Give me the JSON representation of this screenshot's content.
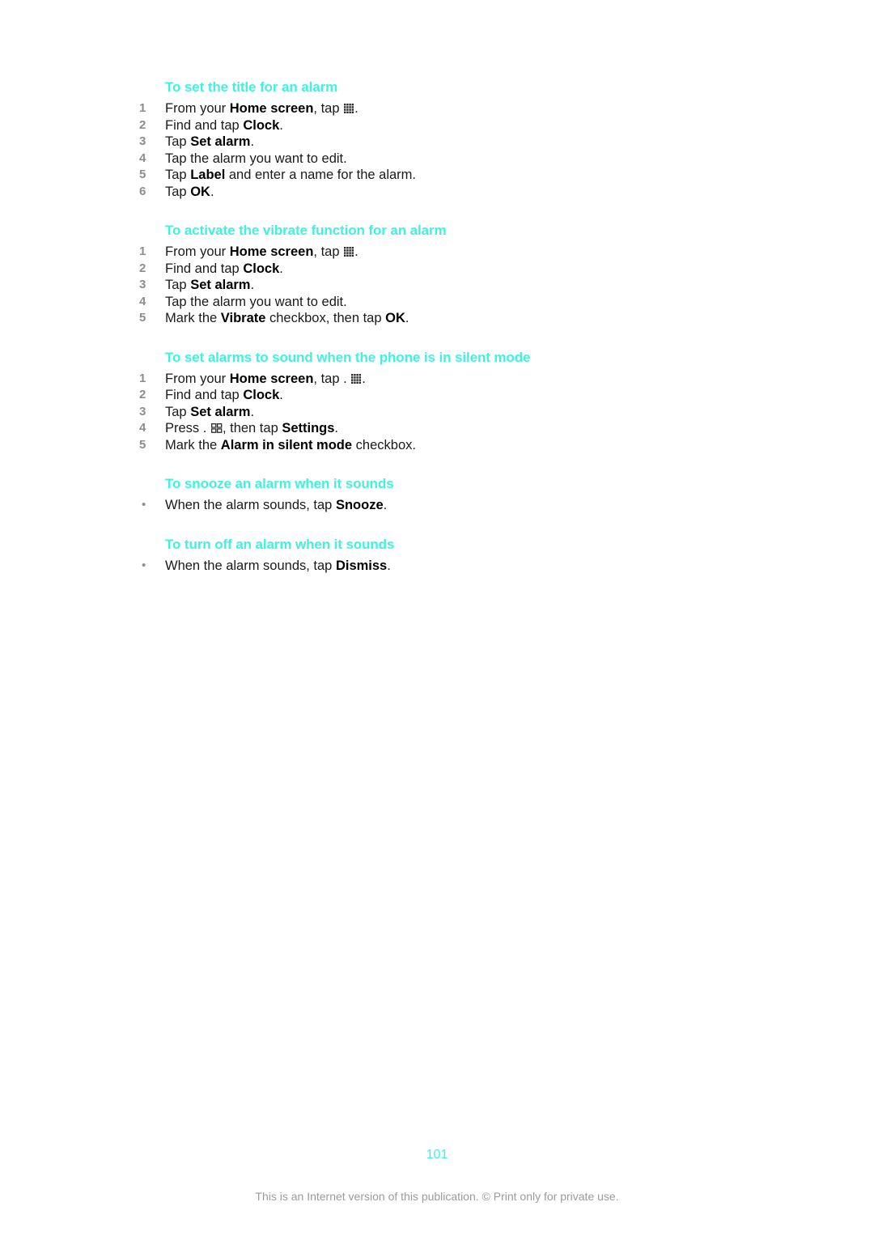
{
  "document": {
    "page_number": "101",
    "footer_note": "This is an Internet version of this publication. © Print only for private use.",
    "heading_color": "#40f2de",
    "body_color": "#1a1a1a",
    "step_number_color": "#8d8d8d",
    "footer_color": "#9b9b9b"
  },
  "sections": [
    {
      "heading": "To set the title for an alarm",
      "list_type": "ordered",
      "steps": [
        {
          "num": "1",
          "pre": "From your ",
          "bold1": "Home screen",
          "mid": ", tap ",
          "icon": "app-drawer-grid-icon",
          "post": "."
        },
        {
          "num": "2",
          "pre": "Find and tap ",
          "bold1": "Clock",
          "mid": "",
          "icon": "",
          "post": "."
        },
        {
          "num": "3",
          "pre": "Tap ",
          "bold1": "Set alarm",
          "mid": "",
          "icon": "",
          "post": "."
        },
        {
          "num": "4",
          "pre": "Tap the alarm you want to edit.",
          "bold1": "",
          "mid": "",
          "icon": "",
          "post": ""
        },
        {
          "num": "5",
          "pre": "Tap ",
          "bold1": "Label",
          "mid": " and enter a name for the alarm.",
          "icon": "",
          "post": ""
        },
        {
          "num": "6",
          "pre": "Tap ",
          "bold1": "OK",
          "mid": "",
          "icon": "",
          "post": "."
        }
      ]
    },
    {
      "heading": "To activate the vibrate function for an alarm",
      "list_type": "ordered",
      "steps": [
        {
          "num": "1",
          "pre": "From your ",
          "bold1": "Home screen",
          "mid": ", tap ",
          "icon": "app-drawer-grid-icon",
          "post": "."
        },
        {
          "num": "2",
          "pre": "Find and tap ",
          "bold1": "Clock",
          "mid": "",
          "icon": "",
          "post": "."
        },
        {
          "num": "3",
          "pre": "Tap ",
          "bold1": "Set alarm",
          "mid": "",
          "icon": "",
          "post": "."
        },
        {
          "num": "4",
          "pre": "Tap the alarm you want to edit.",
          "bold1": "",
          "mid": "",
          "icon": "",
          "post": ""
        },
        {
          "num": "5",
          "pre": "Mark the ",
          "bold1": "Vibrate",
          "mid": " checkbox, then tap ",
          "bold2": "OK",
          "icon": "",
          "post": "."
        }
      ]
    },
    {
      "heading": "To set alarms to sound when the phone is in silent mode",
      "list_type": "ordered",
      "steps": [
        {
          "num": "1",
          "pre": "From your ",
          "bold1": "Home screen",
          "mid": ", tap . ",
          "icon": "app-drawer-grid-icon",
          "post": "."
        },
        {
          "num": "2",
          "pre": "Find and tap ",
          "bold1": "Clock",
          "mid": "",
          "icon": "",
          "post": "."
        },
        {
          "num": "3",
          "pre": "Tap ",
          "bold1": "Set alarm",
          "mid": "",
          "icon": "",
          "post": "."
        },
        {
          "num": "4",
          "pre": "Press . ",
          "icon": "menu-key-icon",
          "mid": ", then tap ",
          "bold1": "Settings",
          "post": "."
        },
        {
          "num": "5",
          "pre": "Mark the ",
          "bold1": "Alarm in silent mode",
          "mid": " checkbox.",
          "icon": "",
          "post": ""
        }
      ]
    },
    {
      "heading": "To snooze an alarm when it sounds",
      "list_type": "bullet",
      "bullets": [
        {
          "pre": "When the alarm sounds, tap ",
          "bold1": "Snooze",
          "post": "."
        }
      ]
    },
    {
      "heading": "To turn off an alarm when it sounds",
      "list_type": "bullet",
      "bullets": [
        {
          "pre": "When the alarm sounds, tap ",
          "bold1": "Dismiss",
          "post": "."
        }
      ]
    }
  ]
}
